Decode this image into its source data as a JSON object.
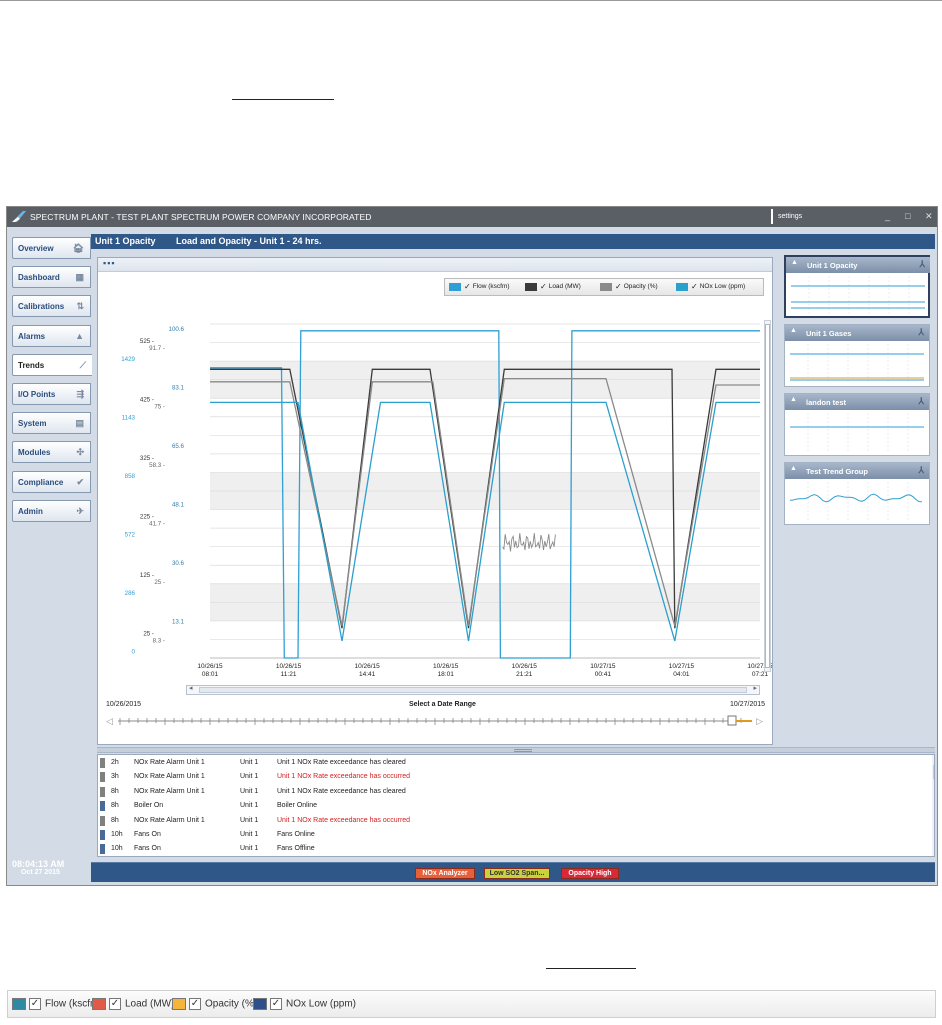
{
  "app": {
    "title": "SPECTRUM PLANT - TEST PLANT SPECTRUM POWER COMPANY INCORPORATED",
    "settings": "settings",
    "window_controls": [
      "_",
      "□",
      "✕"
    ]
  },
  "sidebar": {
    "items": [
      {
        "label": "Overview",
        "icon": "home-icon",
        "glyph": "🏠︎",
        "active": false
      },
      {
        "label": "Dashboard",
        "icon": "grid-icon",
        "glyph": "▦",
        "active": false
      },
      {
        "label": "Calibrations",
        "icon": "sliders-icon",
        "glyph": "⇅",
        "active": false
      },
      {
        "label": "Alarms",
        "icon": "warning-icon",
        "glyph": "▲",
        "active": false
      },
      {
        "label": "Trends",
        "icon": "trend-icon",
        "glyph": "⟋",
        "active": true
      },
      {
        "label": "I/O Points",
        "icon": "network-icon",
        "glyph": "⇶",
        "active": false
      },
      {
        "label": "System",
        "icon": "server-icon",
        "glyph": "▤",
        "active": false
      },
      {
        "label": "Modules",
        "icon": "puzzle-icon",
        "glyph": "✣",
        "active": false
      },
      {
        "label": "Compliance",
        "icon": "check-icon",
        "glyph": "✔",
        "active": false
      },
      {
        "label": "Admin",
        "icon": "tools-icon",
        "glyph": "✈",
        "active": false
      }
    ],
    "clock": {
      "time": "08:04:13 AM",
      "date": "Oct 27 2015"
    }
  },
  "header": {
    "group": "Unit 1 Opacity",
    "title": "Load and Opacity - Unit 1 - 24 hrs."
  },
  "legend": [
    {
      "label": "Flow (kscfm)",
      "color": "#2f9fd4"
    },
    {
      "label": "Load (MW)",
      "color": "#3a3a3a"
    },
    {
      "label": "Opacity (%)",
      "color": "#8a8a8a"
    },
    {
      "label": "NOx Low (ppm)",
      "color": "#2aa0cc"
    }
  ],
  "chart_data": {
    "type": "line",
    "x_ticks": [
      {
        "date": "10/26/15",
        "time": "08:01"
      },
      {
        "date": "10/26/15",
        "time": "11:21"
      },
      {
        "date": "10/26/15",
        "time": "14:41"
      },
      {
        "date": "10/26/15",
        "time": "18:01"
      },
      {
        "date": "10/26/15",
        "time": "21:21"
      },
      {
        "date": "10/27/15",
        "time": "00:41"
      },
      {
        "date": "10/27/15",
        "time": "04:01"
      },
      {
        "date": "10/27/15",
        "time": "07:21"
      }
    ],
    "axes": [
      {
        "name": "opacity",
        "color": "#2f7fb0",
        "ticks": [
          "100.6",
          "83.1",
          "65.6",
          "48.1",
          "30.6",
          "13.1"
        ]
      },
      {
        "name": "nox",
        "color": "#666",
        "ticks": [
          "91.7",
          "75",
          "58.3",
          "41.7",
          "25",
          "8.3"
        ]
      },
      {
        "name": "load",
        "color": "#333",
        "ticks": [
          "525",
          "425",
          "325",
          "225",
          "125",
          "25"
        ]
      },
      {
        "name": "flow",
        "color": "#2f9fd4",
        "ticks": [
          "1429",
          "1143",
          "858",
          "572",
          "286",
          "0"
        ]
      }
    ],
    "x_range": [
      "10/26/15 08:01",
      "10/27/15 08:01"
    ],
    "series": [
      {
        "name": "Flow (kscfm)",
        "color": "#2f9fd4",
        "y_axis": "flow",
        "points": [
          [
            0,
            1286
          ],
          [
            0.13,
            1286
          ],
          [
            0.135,
            0
          ],
          [
            0.16,
            0
          ],
          [
            0.165,
            1450
          ],
          [
            0.23,
            1450
          ],
          [
            0.4,
            1450
          ],
          [
            0.435,
            1450
          ],
          [
            0.525,
            1450
          ],
          [
            0.528,
            0
          ],
          [
            0.655,
            0
          ],
          [
            0.658,
            1450
          ],
          [
            0.87,
            1450
          ],
          [
            0.885,
            1450
          ],
          [
            1,
            1450
          ]
        ]
      },
      {
        "name": "Load (MW)",
        "color": "#3a3a3a",
        "y_axis": "load",
        "points": [
          [
            0,
            484
          ],
          [
            0.145,
            484
          ],
          [
            0.24,
            50
          ],
          [
            0.295,
            484
          ],
          [
            0.4,
            484
          ],
          [
            0.47,
            50
          ],
          [
            0.535,
            484
          ],
          [
            0.655,
            484
          ],
          [
            0.72,
            484
          ],
          [
            0.84,
            484
          ],
          [
            0.845,
            50
          ],
          [
            0.92,
            484
          ],
          [
            1,
            484
          ]
        ]
      },
      {
        "name": "Opacity (%)",
        "color": "#8a8a8a",
        "y_axis": "opacity",
        "points": [
          [
            0,
            86
          ],
          [
            0.145,
            86
          ],
          [
            0.24,
            10
          ],
          [
            0.295,
            86
          ],
          [
            0.405,
            86
          ],
          [
            0.47,
            10
          ],
          [
            0.535,
            87
          ],
          [
            0.655,
            87
          ],
          [
            0.72,
            87
          ],
          [
            0.845,
            10
          ],
          [
            0.92,
            85
          ],
          [
            1,
            85
          ]
        ]
      },
      {
        "name": "NOx Low (ppm)",
        "color": "#2aa0cc",
        "y_axis": "nox",
        "points": [
          [
            0,
            75
          ],
          [
            0.16,
            75
          ],
          [
            0.24,
            5
          ],
          [
            0.31,
            75
          ],
          [
            0.4,
            75
          ],
          [
            0.47,
            5
          ],
          [
            0.535,
            75
          ],
          [
            0.655,
            75
          ],
          [
            0.72,
            75
          ],
          [
            0.845,
            5
          ],
          [
            0.92,
            75
          ],
          [
            1,
            75
          ]
        ]
      }
    ]
  },
  "date_range": {
    "start": "10/26/2015",
    "label": "Select a Date Range",
    "end": "10/27/2015"
  },
  "trend_groups": [
    {
      "name": "Unit 1 Opacity",
      "selected": true
    },
    {
      "name": "Unit 1 Gases",
      "selected": false
    },
    {
      "name": "landon test",
      "selected": false
    },
    {
      "name": "Test Trend Group",
      "selected": false
    }
  ],
  "events": [
    {
      "age": "2h",
      "type": "NOx Rate Alarm Unit 1",
      "unit": "Unit 1",
      "message": "Unit 1 NOx Rate exceedance has cleared",
      "alert": false,
      "marker": "#808080"
    },
    {
      "age": "3h",
      "type": "NOx Rate Alarm Unit 1",
      "unit": "Unit 1",
      "message": "Unit 1 NOx Rate exceedance has occurred",
      "alert": true,
      "marker": "#808080"
    },
    {
      "age": "8h",
      "type": "NOx Rate Alarm Unit 1",
      "unit": "Unit 1",
      "message": "Unit 1 NOx Rate exceedance has cleared",
      "alert": false,
      "marker": "#808080"
    },
    {
      "age": "8h",
      "type": "Boiler On",
      "unit": "Unit 1",
      "message": "Boiler Online",
      "alert": false,
      "marker": "#4a6a9a"
    },
    {
      "age": "8h",
      "type": "NOx Rate Alarm Unit 1",
      "unit": "Unit 1",
      "message": "Unit 1 NOx Rate exceedance has occurred",
      "alert": true,
      "marker": "#808080"
    },
    {
      "age": "10h",
      "type": "Fans On",
      "unit": "Unit 1",
      "message": "Fans Online",
      "alert": false,
      "marker": "#4a6a9a"
    },
    {
      "age": "10h",
      "type": "Fans On",
      "unit": "Unit 1",
      "message": "Fans Offline",
      "alert": false,
      "marker": "#4a6a9a"
    }
  ],
  "status_badges": [
    {
      "label": "NOx Analyzer",
      "color": "#e8603a",
      "text_color": "#fff"
    },
    {
      "label": "Low SO2 Span...",
      "color": "#c9d23a",
      "text_color": "#333"
    },
    {
      "label": "Opacity High",
      "color": "#d8283a",
      "text_color": "#fff"
    }
  ],
  "footer_legend": [
    {
      "label": "Flow (kscfm)",
      "color": "#2e8aa3"
    },
    {
      "label": "Load (MW)",
      "color": "#e05a48"
    },
    {
      "label": "Opacity (%)",
      "color": "#f5b53a"
    },
    {
      "label": "NOx Low (ppm)",
      "color": "#2f4f8a"
    }
  ],
  "check_glyph": "✓"
}
